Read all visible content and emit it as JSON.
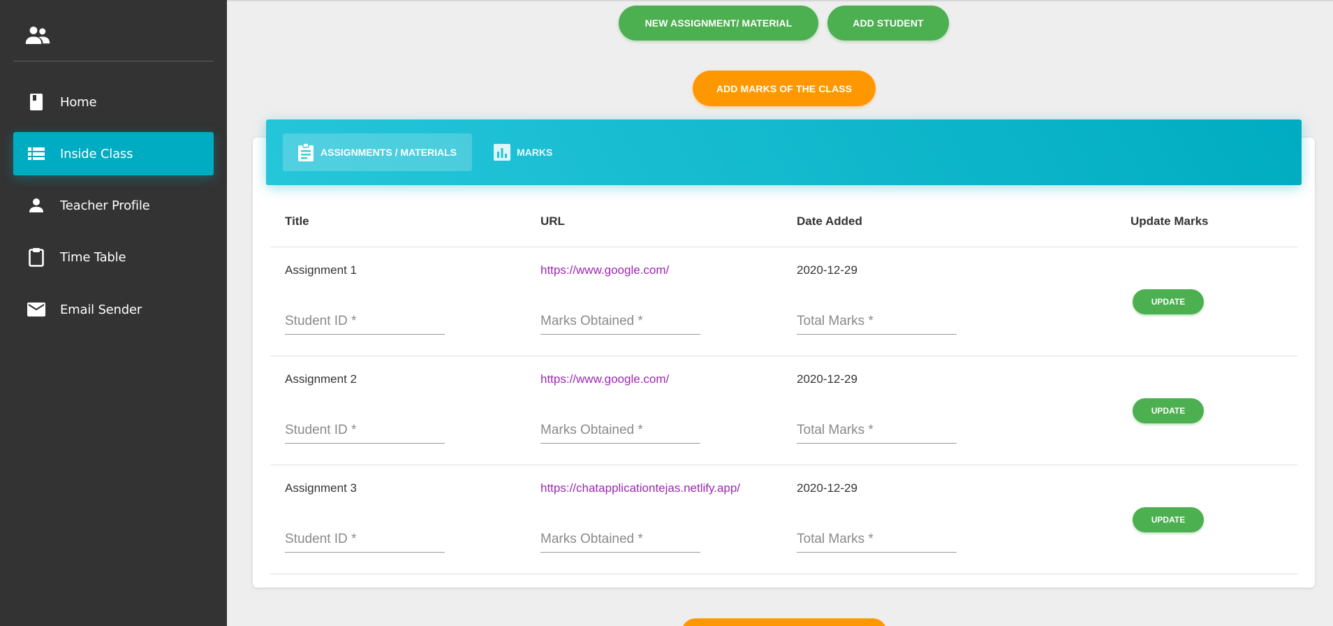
{
  "sidebar": {
    "logo_icon": "people-icon",
    "items": [
      {
        "label": "Home",
        "icon": "book-icon",
        "active": false
      },
      {
        "label": "Inside Class",
        "icon": "list-icon",
        "active": true
      },
      {
        "label": "Teacher Profile",
        "icon": "person-icon",
        "active": false
      },
      {
        "label": "Time Table",
        "icon": "clipboard-icon",
        "active": false
      },
      {
        "label": "Email Sender",
        "icon": "mail-icon",
        "active": false
      }
    ]
  },
  "actions": {
    "new_assignment": "NEW ASSIGNMENT/ MATERIAL",
    "add_student": "ADD STUDENT",
    "add_marks": "ADD MARKS OF THE CLASS"
  },
  "tabs": [
    {
      "label": "ASSIGNMENTS / MATERIALS",
      "icon": "assignment-icon",
      "active": true
    },
    {
      "label": "MARKS",
      "icon": "bar-chart-icon",
      "active": false
    }
  ],
  "table": {
    "headers": [
      "Title",
      "URL",
      "Date Added",
      "Update Marks"
    ],
    "rows": [
      {
        "title": "Assignment 1",
        "url": "https://www.google.com/",
        "date": "2020-12-29",
        "student_id_placeholder": "Student ID *",
        "marks_placeholder": "Marks Obtained *",
        "total_placeholder": "Total Marks *",
        "update_label": "UPDATE"
      },
      {
        "title": "Assignment 2",
        "url": "https://www.google.com/",
        "date": "2020-12-29",
        "student_id_placeholder": "Student ID *",
        "marks_placeholder": "Marks Obtained *",
        "total_placeholder": "Total Marks *",
        "update_label": "UPDATE"
      },
      {
        "title": "Assignment 3",
        "url": "https://chatapplicationtejas.netlify.app/",
        "date": "2020-12-29",
        "student_id_placeholder": "Student ID *",
        "marks_placeholder": "Marks Obtained *",
        "total_placeholder": "Total Marks *",
        "update_label": "UPDATE"
      }
    ]
  },
  "colors": {
    "sidebar_bg": "#333333",
    "accent_cyan": "#00acc1",
    "green": "#4caf50",
    "orange": "#ff9800",
    "link_purple": "#9c27b0"
  }
}
